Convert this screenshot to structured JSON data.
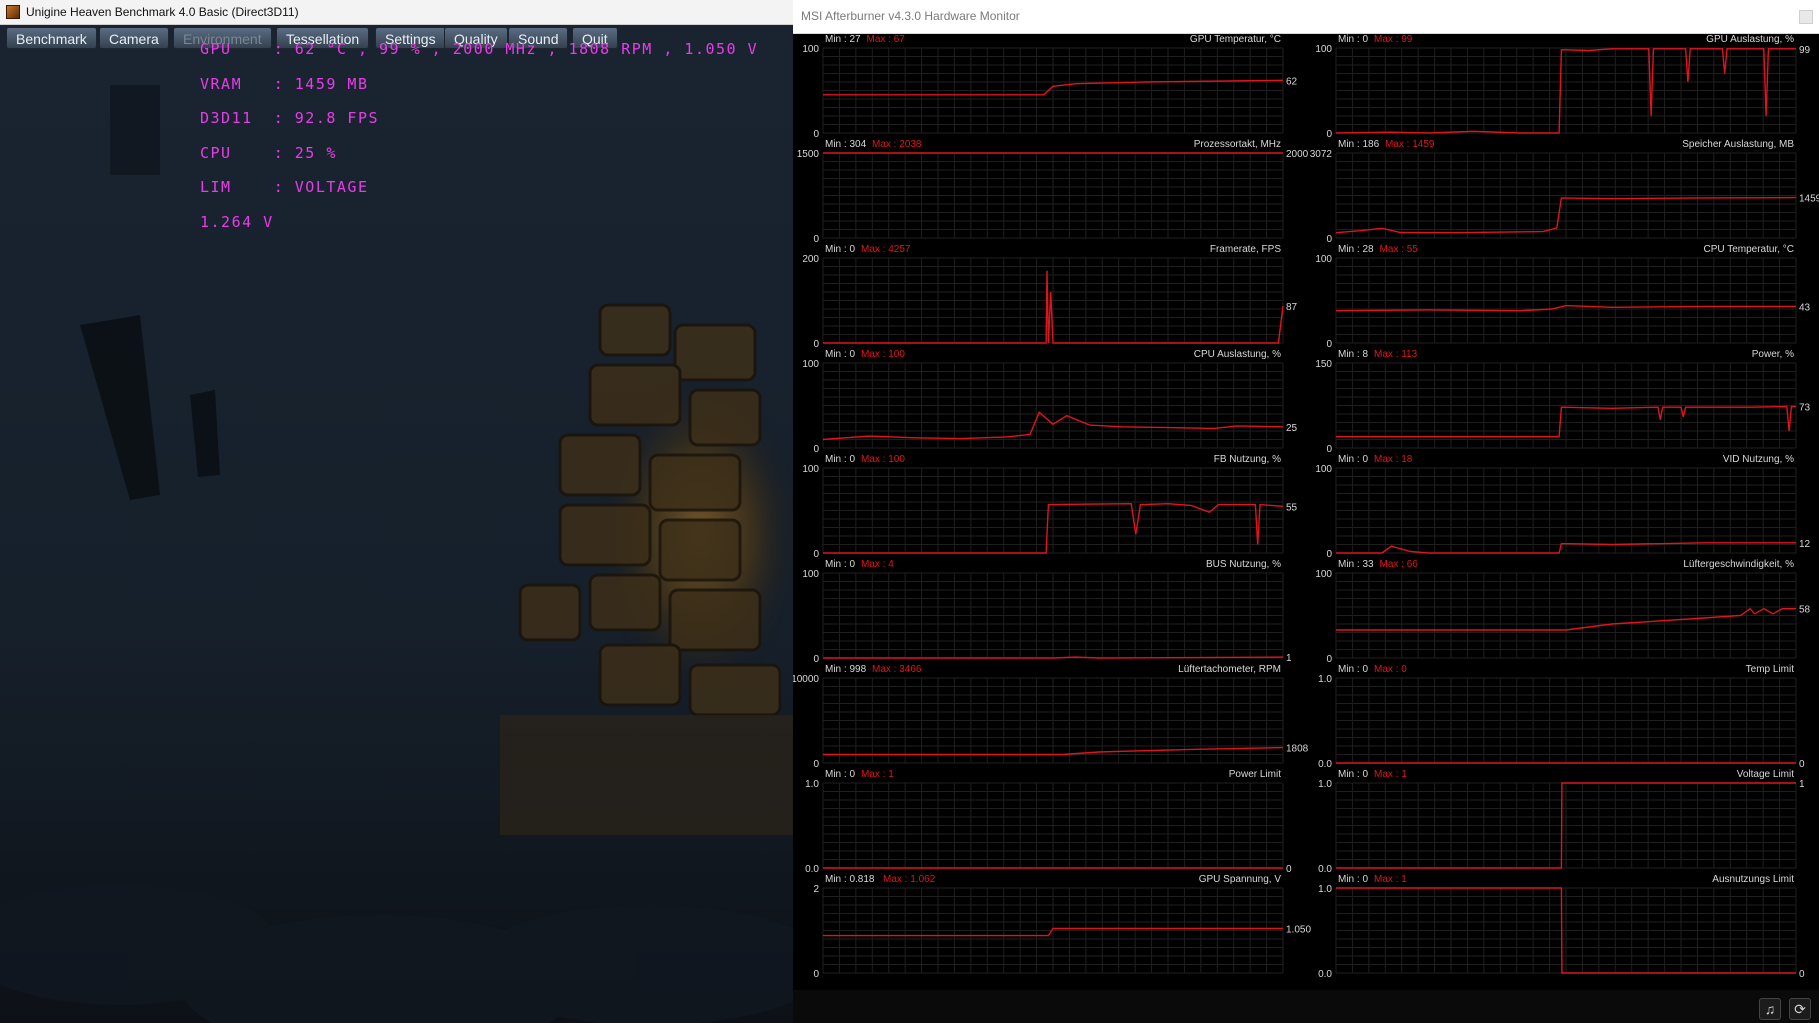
{
  "heaven": {
    "title": "Unigine Heaven Benchmark 4.0 Basic (Direct3D11)",
    "menu": [
      "Benchmark",
      "Camera",
      "Environment",
      "Tessellation",
      "Settings",
      "Quality",
      "Sound",
      "Quit"
    ],
    "osd_lines": [
      "GPU    : 62 °C , 99 % , 2000 MHz , 1808 RPM , 1.050 V",
      "VRAM   : 1459 MB",
      "D3D11  : 92.8 FPS",
      "CPU    : 25 %",
      "LIM    : VOLTAGE",
      "1.264 V"
    ]
  },
  "afterburner": {
    "title": "MSI Afterburner v4.3.0 Hardware Monitor",
    "colors": {
      "line": "#e0141e",
      "max_label": "#e0141e",
      "text": "#d8d8d8",
      "grid": "#1f1f1f"
    },
    "graphs": [
      {
        "name": "GPU Temperatur, °C",
        "min_label": "Min : 27",
        "max_label": "Max : 67",
        "ymax": "100",
        "ymin": "0",
        "ymax_v": 100,
        "ymin_v": 0,
        "current": "62",
        "col": 0,
        "row": 0,
        "points": [
          [
            0,
            45
          ],
          [
            0.48,
            45
          ],
          [
            0.5,
            55
          ],
          [
            0.55,
            58
          ],
          [
            0.7,
            60
          ],
          [
            1,
            62
          ]
        ]
      },
      {
        "name": "Prozessortakt, MHz",
        "min_label": "Min : 304",
        "max_label": "Max : 2038",
        "ymax": "1500",
        "ymin": "0",
        "ymax_v": 1500,
        "ymin_v": 0,
        "current": "2000",
        "col": 0,
        "row": 1,
        "points": [
          [
            0,
            1500
          ],
          [
            1,
            1500
          ]
        ]
      },
      {
        "name": "Framerate, FPS",
        "min_label": "Min : 0",
        "max_label": "Max : 4257",
        "ymax": "200",
        "ymin": "0",
        "ymax_v": 200,
        "ymin_v": 0,
        "current": "87",
        "col": 0,
        "row": 2,
        "points": [
          [
            0,
            0
          ],
          [
            0.485,
            0
          ],
          [
            0.487,
            170
          ],
          [
            0.49,
            0
          ],
          [
            0.495,
            120
          ],
          [
            0.5,
            0
          ],
          [
            0.99,
            0
          ],
          [
            1,
            87
          ]
        ]
      },
      {
        "name": "CPU Auslastung, %",
        "min_label": "Min : 0",
        "max_label": "Max : 100",
        "ymax": "100",
        "ymin": "0",
        "ymax_v": 100,
        "ymin_v": 0,
        "current": "25",
        "col": 0,
        "row": 3,
        "points": [
          [
            0,
            10
          ],
          [
            0.1,
            14
          ],
          [
            0.2,
            12
          ],
          [
            0.3,
            11
          ],
          [
            0.4,
            13
          ],
          [
            0.45,
            16
          ],
          [
            0.47,
            42
          ],
          [
            0.5,
            28
          ],
          [
            0.53,
            38
          ],
          [
            0.58,
            27
          ],
          [
            0.65,
            25
          ],
          [
            0.75,
            24
          ],
          [
            0.85,
            23
          ],
          [
            0.9,
            26
          ],
          [
            1,
            25
          ]
        ]
      },
      {
        "name": "FB Nutzung, %",
        "min_label": "Min : 0",
        "max_label": "Max : 100",
        "ymax": "100",
        "ymin": "0",
        "ymax_v": 100,
        "ymin_v": 0,
        "current": "55",
        "col": 0,
        "row": 4,
        "points": [
          [
            0,
            0
          ],
          [
            0.485,
            0
          ],
          [
            0.49,
            57
          ],
          [
            0.67,
            58
          ],
          [
            0.68,
            22
          ],
          [
            0.69,
            57
          ],
          [
            0.75,
            58
          ],
          [
            0.8,
            56
          ],
          [
            0.84,
            48
          ],
          [
            0.86,
            57
          ],
          [
            0.94,
            57
          ],
          [
            0.945,
            10
          ],
          [
            0.95,
            57
          ],
          [
            1,
            55
          ]
        ]
      },
      {
        "name": "BUS Nutzung, %",
        "min_label": "Min : 0",
        "max_label": "Max : 4",
        "ymax": "100",
        "ymin": "0",
        "ymax_v": 100,
        "ymin_v": 0,
        "current": "1",
        "col": 0,
        "row": 5,
        "points": [
          [
            0,
            0
          ],
          [
            0.5,
            0
          ],
          [
            0.55,
            1
          ],
          [
            0.6,
            0
          ],
          [
            1,
            1
          ]
        ]
      },
      {
        "name": "Lüftertachometer, RPM",
        "min_label": "Min : 998",
        "max_label": "Max : 3466",
        "ymax": "10000",
        "ymin": "0",
        "ymax_v": 10000,
        "ymin_v": 0,
        "current": "1808",
        "col": 0,
        "row": 6,
        "points": [
          [
            0,
            1000
          ],
          [
            0.52,
            1000
          ],
          [
            0.6,
            1300
          ],
          [
            0.8,
            1600
          ],
          [
            1,
            1808
          ]
        ]
      },
      {
        "name": "Power Limit",
        "min_label": "Min : 0",
        "max_label": "Max : 1",
        "ymax": "1.0",
        "ymin": "0.0",
        "ymax_v": 1,
        "ymin_v": 0,
        "current": "0",
        "col": 0,
        "row": 7,
        "points": [
          [
            0,
            0
          ],
          [
            1,
            0
          ]
        ]
      },
      {
        "name": "GPU Spannung, V",
        "min_label": "Min : 0.818",
        "max_label": "Max : 1.062",
        "ymax": "2",
        "ymin": "0",
        "ymax_v": 2,
        "ymin_v": 0,
        "current": "1.050",
        "col": 0,
        "row": 8,
        "points": [
          [
            0,
            0.88
          ],
          [
            0.49,
            0.88
          ],
          [
            0.5,
            1.05
          ],
          [
            1,
            1.05
          ]
        ]
      },
      {
        "name": "GPU Auslastung, %",
        "min_label": "Min : 0",
        "max_label": "Max : 99",
        "ymax": "100",
        "ymin": "0",
        "ymax_v": 100,
        "ymin_v": 0,
        "current": "99",
        "col": 1,
        "row": 0,
        "points": [
          [
            0,
            0
          ],
          [
            0.12,
            1
          ],
          [
            0.2,
            0
          ],
          [
            0.3,
            2
          ],
          [
            0.4,
            0
          ],
          [
            0.485,
            0
          ],
          [
            0.49,
            98
          ],
          [
            0.55,
            97
          ],
          [
            0.6,
            99
          ],
          [
            0.68,
            99
          ],
          [
            0.685,
            20
          ],
          [
            0.69,
            99
          ],
          [
            0.76,
            99
          ],
          [
            0.765,
            60
          ],
          [
            0.77,
            99
          ],
          [
            0.84,
            99
          ],
          [
            0.845,
            70
          ],
          [
            0.85,
            99
          ],
          [
            0.93,
            99
          ],
          [
            0.935,
            20
          ],
          [
            0.94,
            99
          ],
          [
            1,
            99
          ]
        ]
      },
      {
        "name": "Speicher Auslastung, MB",
        "min_label": "Min : 186",
        "max_label": "Max : 1459",
        "ymax": "3072",
        "ymin": "0",
        "ymax_v": 3072,
        "ymin_v": 0,
        "current": "1459",
        "col": 1,
        "row": 1,
        "points": [
          [
            0,
            190
          ],
          [
            0.05,
            260
          ],
          [
            0.1,
            350
          ],
          [
            0.14,
            200
          ],
          [
            0.25,
            190
          ],
          [
            0.45,
            230
          ],
          [
            0.48,
            360
          ],
          [
            0.49,
            1450
          ],
          [
            0.6,
            1420
          ],
          [
            0.8,
            1450
          ],
          [
            1,
            1459
          ]
        ]
      },
      {
        "name": "CPU Temperatur, °C",
        "min_label": "Min : 28",
        "max_label": "Max : 55",
        "ymax": "100",
        "ymin": "0",
        "ymax_v": 100,
        "ymin_v": 0,
        "current": "43",
        "col": 1,
        "row": 2,
        "points": [
          [
            0,
            38
          ],
          [
            0.2,
            39
          ],
          [
            0.4,
            38
          ],
          [
            0.47,
            40
          ],
          [
            0.5,
            44
          ],
          [
            0.6,
            42
          ],
          [
            0.8,
            43
          ],
          [
            1,
            43
          ]
        ]
      },
      {
        "name": "Power, %",
        "min_label": "Min : 8",
        "max_label": "Max : 113",
        "ymax": "150",
        "ymin": "0",
        "ymax_v": 150,
        "ymin_v": 0,
        "current": "73",
        "col": 1,
        "row": 3,
        "points": [
          [
            0,
            20
          ],
          [
            0.485,
            20
          ],
          [
            0.49,
            72
          ],
          [
            0.6,
            70
          ],
          [
            0.7,
            72
          ],
          [
            0.705,
            50
          ],
          [
            0.71,
            72
          ],
          [
            0.75,
            72
          ],
          [
            0.755,
            55
          ],
          [
            0.76,
            72
          ],
          [
            0.9,
            72
          ],
          [
            0.98,
            73
          ],
          [
            0.985,
            30
          ],
          [
            0.99,
            73
          ],
          [
            1,
            73
          ]
        ]
      },
      {
        "name": "VID Nutzung, %",
        "min_label": "Min : 0",
        "max_label": "Max : 18",
        "ymax": "100",
        "ymin": "0",
        "ymax_v": 100,
        "ymin_v": 0,
        "current": "12",
        "col": 1,
        "row": 4,
        "points": [
          [
            0,
            0
          ],
          [
            0.1,
            0
          ],
          [
            0.12,
            8
          ],
          [
            0.16,
            2
          ],
          [
            0.2,
            0
          ],
          [
            0.485,
            0
          ],
          [
            0.49,
            11
          ],
          [
            0.6,
            10
          ],
          [
            0.8,
            12
          ],
          [
            1,
            12
          ]
        ]
      },
      {
        "name": "Lüftergeschwindigkeit, %",
        "min_label": "Min : 33",
        "max_label": "Max : 66",
        "ymax": "100",
        "ymin": "0",
        "ymax_v": 100,
        "ymin_v": 0,
        "current": "58",
        "col": 1,
        "row": 5,
        "points": [
          [
            0,
            33
          ],
          [
            0.5,
            33
          ],
          [
            0.6,
            40
          ],
          [
            0.8,
            47
          ],
          [
            0.88,
            50
          ],
          [
            0.9,
            58
          ],
          [
            0.91,
            52
          ],
          [
            0.93,
            58
          ],
          [
            0.95,
            52
          ],
          [
            0.97,
            58
          ],
          [
            1,
            58
          ]
        ]
      },
      {
        "name": "Temp Limit",
        "min_label": "Min : 0",
        "max_label": "Max : 0",
        "ymax": "1.0",
        "ymin": "0.0",
        "ymax_v": 1,
        "ymin_v": 0,
        "current": "0",
        "col": 1,
        "row": 6,
        "points": [
          [
            0,
            0
          ],
          [
            1,
            0
          ]
        ]
      },
      {
        "name": "Voltage Limit",
        "min_label": "Min : 0",
        "max_label": "Max : 1",
        "ymax": "1.0",
        "ymin": "0.0",
        "ymax_v": 1,
        "ymin_v": 0,
        "current": "1",
        "col": 1,
        "row": 7,
        "points": [
          [
            0,
            0
          ],
          [
            0.49,
            0
          ],
          [
            0.491,
            1
          ],
          [
            1,
            1
          ]
        ]
      },
      {
        "name": "Ausnutzungs Limit",
        "min_label": "Min : 0",
        "max_label": "Max : 1",
        "ymax": "1.0",
        "ymin": "0.0",
        "ymax_v": 1,
        "ymin_v": 0,
        "current": "0",
        "col": 1,
        "row": 8,
        "points": [
          [
            0,
            1
          ],
          [
            0.49,
            1
          ],
          [
            0.491,
            0
          ],
          [
            1,
            0
          ]
        ]
      }
    ]
  },
  "bottom_icons": [
    "microphone-icon",
    "refresh-icon"
  ]
}
